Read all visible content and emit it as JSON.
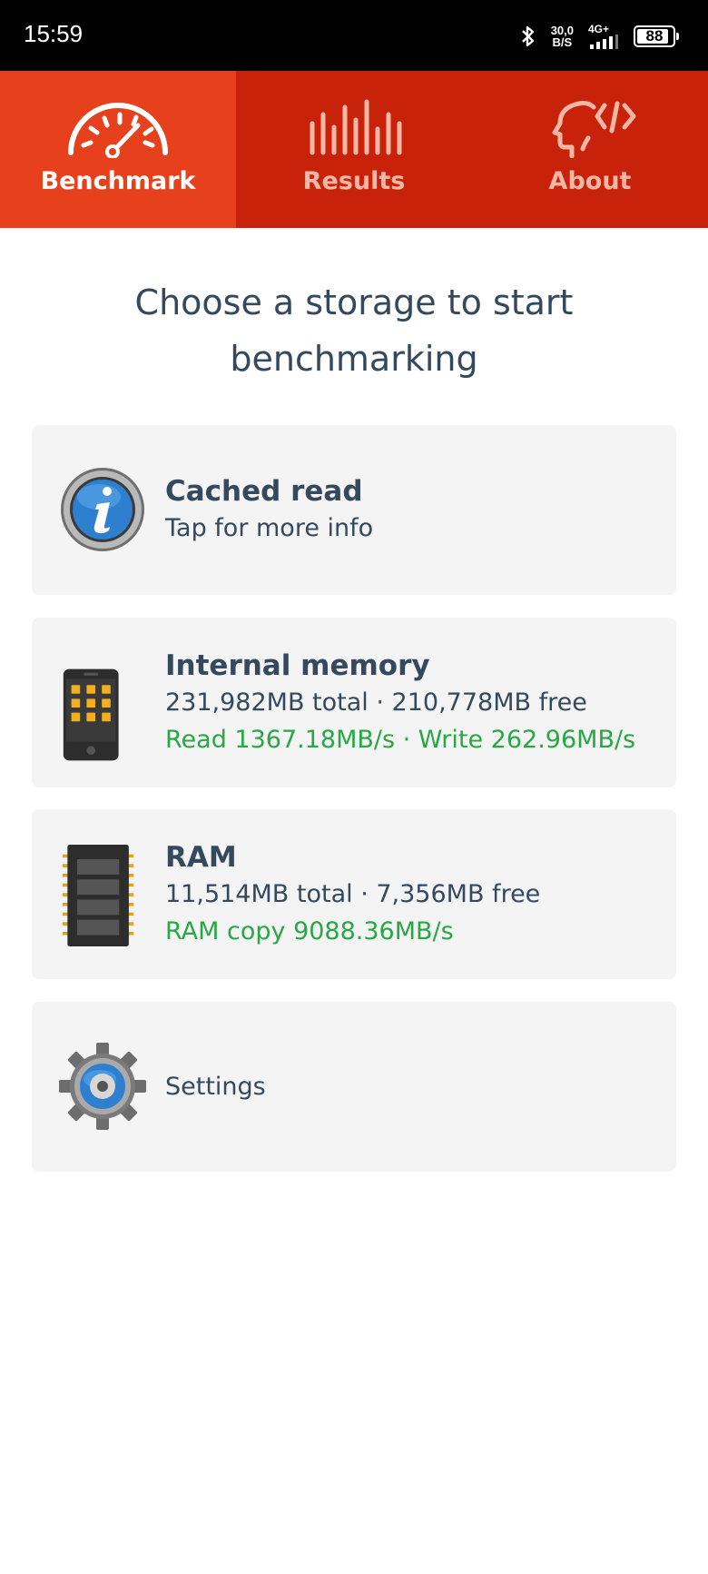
{
  "status_bar": {
    "time": "15:59",
    "net_speed_value": "30,0",
    "net_speed_unit": "B/S",
    "network": "4G+",
    "battery": "88"
  },
  "tabs": [
    {
      "label": "Benchmark",
      "icon": "speedometer-icon",
      "active": true
    },
    {
      "label": "Results",
      "icon": "bars-icon",
      "active": false
    },
    {
      "label": "About",
      "icon": "head-code-icon",
      "active": false
    }
  ],
  "main": {
    "title": "Choose a storage to start benchmarking"
  },
  "cards": {
    "cached": {
      "title": "Cached read",
      "subtitle": "Tap for more info",
      "icon": "info-icon"
    },
    "internal": {
      "title": "Internal memory",
      "detail": "231,982MB total · 210,778MB free",
      "speed": "Read 1367.18MB/s · Write 262.96MB/s",
      "icon": "phone-icon"
    },
    "ram": {
      "title": "RAM",
      "detail": "11,514MB total · 7,356MB free",
      "speed": "RAM copy 9088.36MB/s",
      "icon": "ram-chip-icon"
    },
    "settings": {
      "title": "Settings",
      "icon": "gear-icon"
    }
  },
  "colors": {
    "tab_active": "#e7401c",
    "tab_inactive": "#c8230a",
    "speed_text": "#27a844",
    "text": "#34495e"
  }
}
